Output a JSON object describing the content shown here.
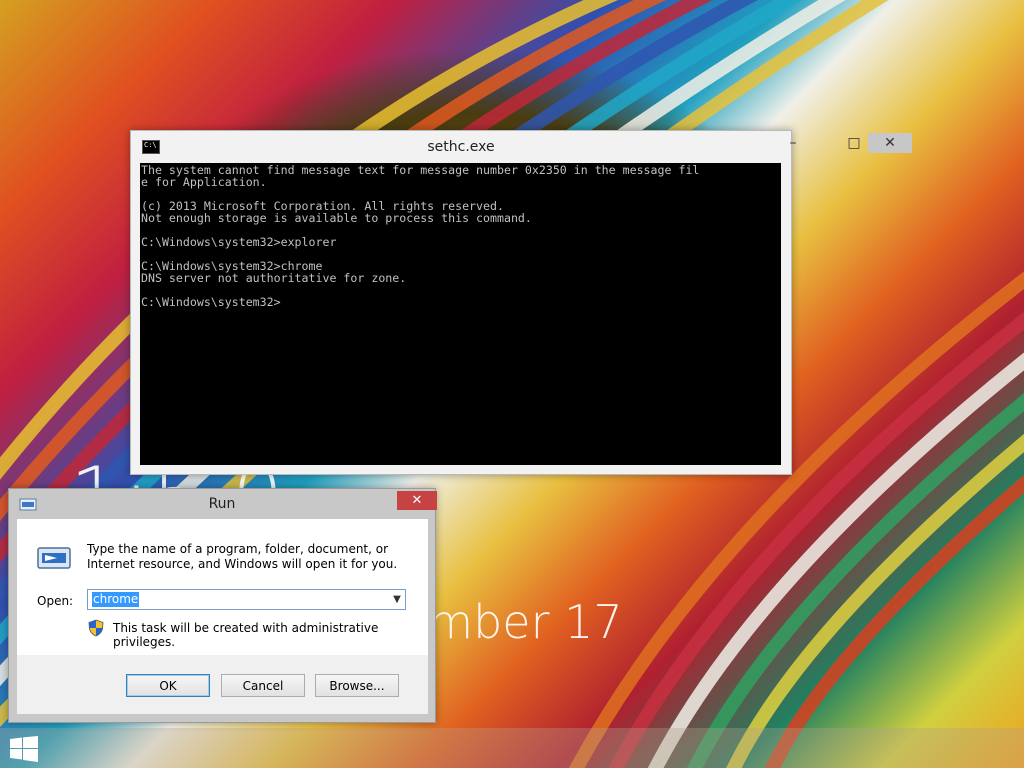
{
  "background": {
    "time_fragment": "1:5 0",
    "date_fragment": "ember 17"
  },
  "console": {
    "title": "sethc.exe",
    "icon": "console-app-icon",
    "window_buttons": {
      "minimize": "–",
      "maximize": "□",
      "close": "✕"
    },
    "lines": [
      "The system cannot find message text for message number 0x2350 in the message fil",
      "e for Application.",
      "",
      "(c) 2013 Microsoft Corporation. All rights reserved.",
      "Not enough storage is available to process this command.",
      "",
      "C:\\Windows\\system32>explorer",
      "",
      "C:\\Windows\\system32>chrome",
      "DNS server not authoritative for zone.",
      "",
      "C:\\Windows\\system32>"
    ]
  },
  "run_dialog": {
    "title": "Run",
    "close_glyph": "✕",
    "description": "Type the name of a program, folder, document, or Internet resource, and Windows will open it for you.",
    "open_label": "Open:",
    "open_value": "chrome",
    "admin_note": "This task will be created with administrative privileges.",
    "buttons": {
      "ok": "OK",
      "cancel": "Cancel",
      "browse": "Browse..."
    }
  },
  "colors": {
    "console_bg": "#000000",
    "console_fg": "#c0c0c0",
    "close_red": "#c74343",
    "selection_blue": "#3399ff"
  }
}
